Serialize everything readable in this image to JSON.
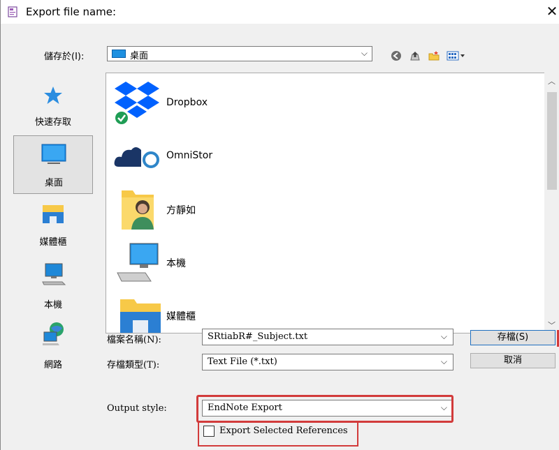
{
  "window": {
    "title": "Export file name:",
    "close_glyph": "✕"
  },
  "save_in": {
    "label": "儲存於(I):",
    "value": "桌面",
    "chevron": "⌵"
  },
  "places": [
    {
      "label": "快速存取",
      "icon": "star-icon"
    },
    {
      "label": "桌面",
      "icon": "desktop-icon",
      "selected": true
    },
    {
      "label": "媒體櫃",
      "icon": "library-icon"
    },
    {
      "label": "本機",
      "icon": "computer-icon"
    },
    {
      "label": "網路",
      "icon": "network-icon"
    }
  ],
  "files": [
    {
      "name": "Dropbox",
      "icon": "dropbox-icon"
    },
    {
      "name": "OmniStor",
      "icon": "cloud-icon"
    },
    {
      "name": "方靜如",
      "icon": "user-folder-icon"
    },
    {
      "name": "本機",
      "icon": "computer-icon"
    },
    {
      "name": "媒體櫃",
      "icon": "library-icon"
    }
  ],
  "fields": {
    "filename_label": "檔案名稱(N):",
    "filename_value": "SRtiabR#_Subject.txt",
    "filetype_label": "存檔類型(T):",
    "filetype_value": "Text File (*.txt)",
    "output_label": "Output style:",
    "output_value": "EndNote Export",
    "export_selected_label": "Export Selected References",
    "export_selected_checked": false
  },
  "buttons": {
    "save": "存檔(S)",
    "cancel": "取消"
  },
  "colors": {
    "highlight_red": "#d23b3b",
    "folder_yellow": "#f7c948",
    "accent_blue": "#0078d7"
  }
}
